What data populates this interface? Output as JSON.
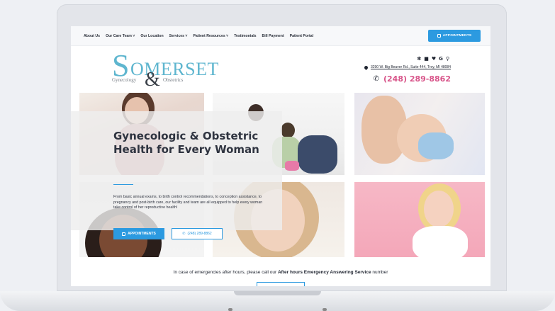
{
  "nav": {
    "items": [
      "About Us",
      "Our Care Team ˅",
      "Our Location",
      "Services ˅",
      "Patient Resources ˅",
      "Testimonials",
      "Bill Payment",
      "Patient Portal"
    ],
    "appointments_label": "APPOINTMENTS"
  },
  "logo": {
    "initial": "S",
    "word": "OMERSET",
    "amp": "&",
    "left_text": "Gynecology",
    "right_text": "Obstetrics"
  },
  "header": {
    "social_icons": [
      "yelp-icon",
      "facebook-icon",
      "healthgrades-icon",
      "google-icon",
      "search-icon"
    ],
    "address": "3290 W. Big Beaver Rd., Suite 444, Troy, MI 48084",
    "phone": "(248) 289-8862"
  },
  "hero": {
    "title": "Gynecologic & Obstetric Health for Every Woman",
    "body": "From basic annual exams, to birth control recommendations, to conception assistance, to pregnancy and post-birth care, our facility and team are all equipped to help every woman take control of her reproductive health!",
    "appointments_label": "APPOINTMENTS",
    "phone_label": "(248) 289-8862"
  },
  "emergency": {
    "prefix": "In case of emergencies after hours, please call our ",
    "bold": "After hours Emergency Answering Service",
    "suffix": " number"
  },
  "colors": {
    "accent_blue": "#2c9ae0",
    "phone_pink": "#d8558a",
    "logo_teal": "#5fb6cf"
  }
}
